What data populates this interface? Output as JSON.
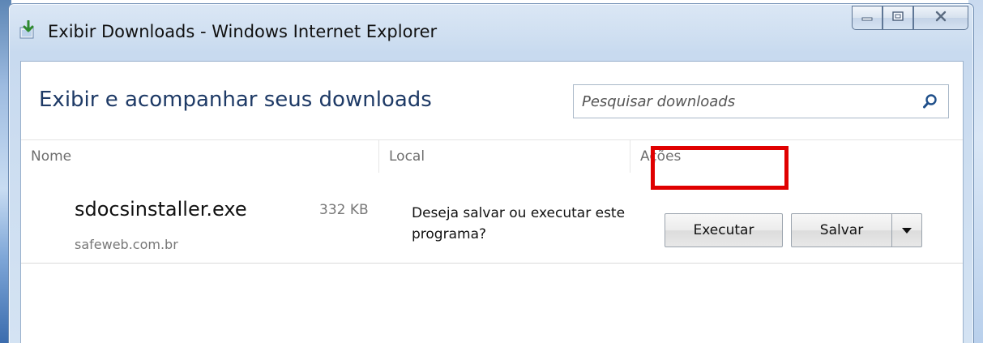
{
  "window": {
    "title": "Exibir Downloads - Windows Internet Explorer",
    "controls": {
      "minimize": "minimize-icon",
      "maximize": "maximize-icon",
      "close": "close-icon"
    }
  },
  "header": {
    "heading": "Exibir e acompanhar seus downloads",
    "search": {
      "placeholder": "Pesquisar downloads",
      "value": ""
    }
  },
  "columns": {
    "name": "Nome",
    "location": "Local",
    "actions": "Ações"
  },
  "downloads": [
    {
      "file_name": "sdocsinstaller.exe",
      "size": "332 KB",
      "source": "safeweb.com.br",
      "prompt": "Deseja salvar ou executar este programa?",
      "run_label": "Executar",
      "save_label": "Salvar"
    }
  ],
  "colors": {
    "heading": "#1e3a66",
    "highlight": "#e00000",
    "window_frame": "#cfdff1"
  }
}
